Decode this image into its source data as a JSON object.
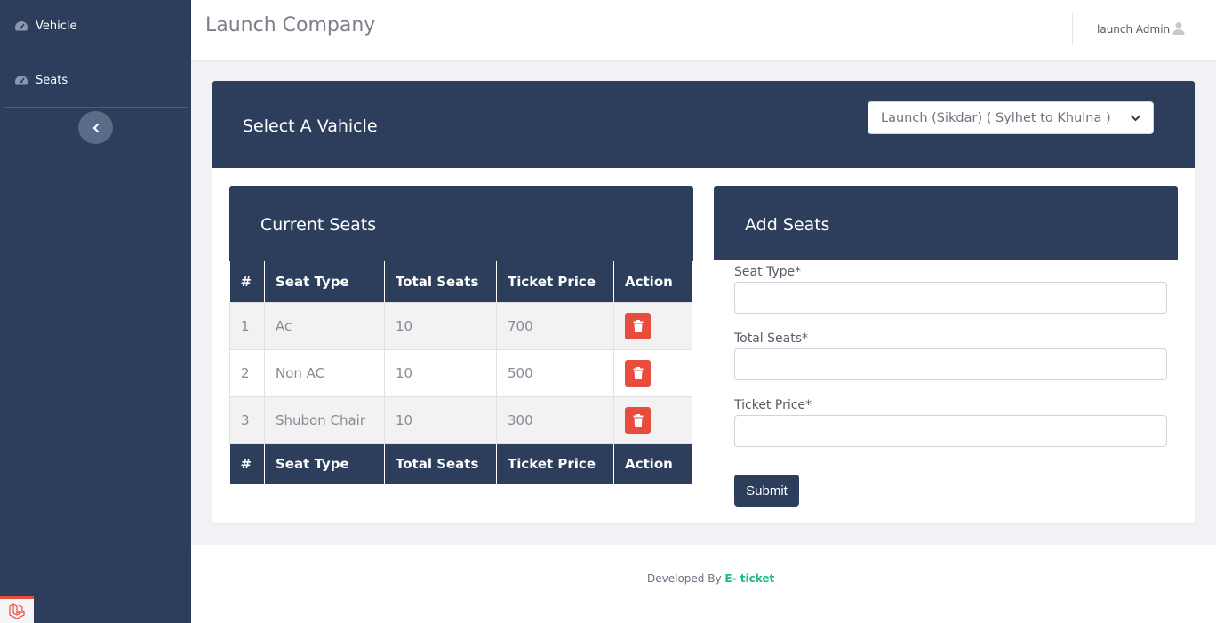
{
  "sidebar": {
    "items": [
      {
        "label": "Vehicle",
        "icon": "dashboard-gauge-icon"
      },
      {
        "label": "Seats",
        "icon": "dashboard-gauge-icon"
      }
    ],
    "collapse_icon": "chevron-left-icon"
  },
  "header": {
    "brand": "Launch Company",
    "user_name": "launch Admin",
    "user_icon": "user-icon"
  },
  "vehicle_panel": {
    "title": "Select A Vahicle",
    "selected_vehicle": "Launch (Sikdar) ( Sylhet to Khulna )"
  },
  "current_seats": {
    "title": "Current Seats",
    "columns": [
      "#",
      "Seat Type",
      "Total Seats",
      "Ticket Price",
      "Action"
    ],
    "rows": [
      {
        "num": "1",
        "type": "Ac",
        "total": "10",
        "price": "700"
      },
      {
        "num": "2",
        "type": "Non AC",
        "total": "10",
        "price": "500"
      },
      {
        "num": "3",
        "type": "Shubon Chair",
        "total": "10",
        "price": "300"
      }
    ]
  },
  "add_seats": {
    "title": "Add Seats",
    "seat_type_label": "Seat Type*",
    "total_seats_label": "Total Seats*",
    "ticket_price_label": "Ticket Price*",
    "submit_label": "Submit"
  },
  "footer": {
    "prefix": "Developed By",
    "brand": "E- ticket"
  },
  "colors": {
    "primary_navy": "#2c3e5c",
    "danger": "#e74c3c",
    "footer_brand": "#1cbb8c"
  }
}
